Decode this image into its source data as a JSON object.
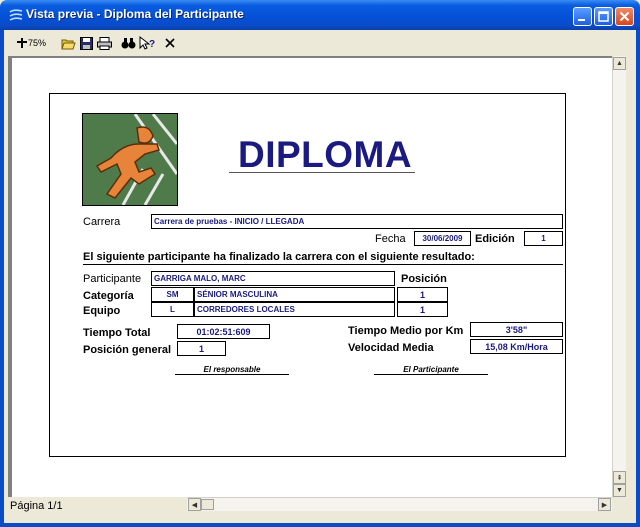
{
  "window": {
    "title": "Vista previa - Diploma del Participante"
  },
  "toolbar": {
    "zoom": "75%"
  },
  "status": {
    "page": "Página 1/1"
  },
  "diploma": {
    "title": "DIPLOMA",
    "carrera_label": "Carrera",
    "carrera_value": "Carrera de pruebas - INICIO / LLEGADA",
    "fecha_label": "Fecha",
    "fecha_value": "30/06/2009",
    "edicion_label": "Edición",
    "edicion_value": "1",
    "intro": "El siguiente participante ha finalizado la carrera con el siguiente resultado:",
    "participante_label": "Participante",
    "participante_value": "GARRIGA MALO, MARC",
    "posicion_label": "Posición",
    "categoria_label": "Categoría",
    "categoria_code": "SM",
    "categoria_name": "SÉNIOR MASCULINA",
    "categoria_pos": "1",
    "equipo_label": "Equipo",
    "equipo_code": "L",
    "equipo_name": "CORREDORES LOCALES",
    "equipo_pos": "1",
    "tiempo_total_label": "Tiempo Total",
    "tiempo_total_value": "01:02:51:609",
    "posicion_general_label": "Posición general",
    "posicion_general_value": "1",
    "tiempo_medio_label": "Tiempo Medio por Km",
    "tiempo_medio_value": "3'58\"",
    "velocidad_label": "Velocidad Media",
    "velocidad_value": "15,08 Km/Hora",
    "responsable_label": "El responsable",
    "participante_sig_label": "El Participante"
  },
  "colors": {
    "titlebar": "#0a5ddf",
    "field_text": "#1a1a80",
    "logo_bg": "#4f7a4a",
    "runner": "#e8843a"
  }
}
